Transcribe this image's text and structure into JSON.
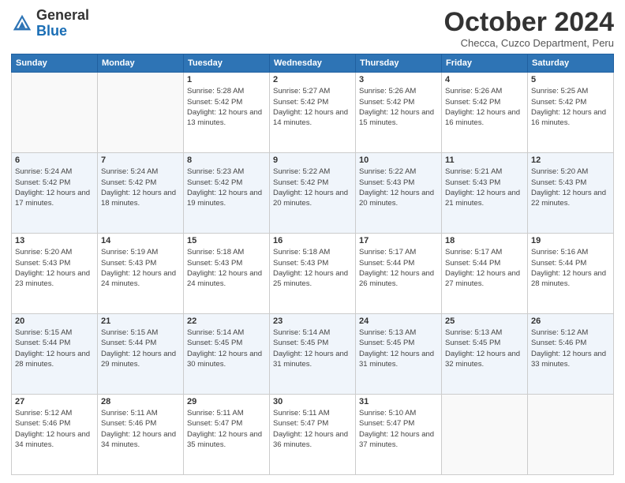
{
  "logo": {
    "general": "General",
    "blue": "Blue"
  },
  "header": {
    "month": "October 2024",
    "location": "Checca, Cuzco Department, Peru"
  },
  "days_of_week": [
    "Sunday",
    "Monday",
    "Tuesday",
    "Wednesday",
    "Thursday",
    "Friday",
    "Saturday"
  ],
  "weeks": [
    [
      {
        "day": "",
        "sunrise": "",
        "sunset": "",
        "daylight": ""
      },
      {
        "day": "",
        "sunrise": "",
        "sunset": "",
        "daylight": ""
      },
      {
        "day": "1",
        "sunrise": "Sunrise: 5:28 AM",
        "sunset": "Sunset: 5:42 PM",
        "daylight": "Daylight: 12 hours and 13 minutes."
      },
      {
        "day": "2",
        "sunrise": "Sunrise: 5:27 AM",
        "sunset": "Sunset: 5:42 PM",
        "daylight": "Daylight: 12 hours and 14 minutes."
      },
      {
        "day": "3",
        "sunrise": "Sunrise: 5:26 AM",
        "sunset": "Sunset: 5:42 PM",
        "daylight": "Daylight: 12 hours and 15 minutes."
      },
      {
        "day": "4",
        "sunrise": "Sunrise: 5:26 AM",
        "sunset": "Sunset: 5:42 PM",
        "daylight": "Daylight: 12 hours and 16 minutes."
      },
      {
        "day": "5",
        "sunrise": "Sunrise: 5:25 AM",
        "sunset": "Sunset: 5:42 PM",
        "daylight": "Daylight: 12 hours and 16 minutes."
      }
    ],
    [
      {
        "day": "6",
        "sunrise": "Sunrise: 5:24 AM",
        "sunset": "Sunset: 5:42 PM",
        "daylight": "Daylight: 12 hours and 17 minutes."
      },
      {
        "day": "7",
        "sunrise": "Sunrise: 5:24 AM",
        "sunset": "Sunset: 5:42 PM",
        "daylight": "Daylight: 12 hours and 18 minutes."
      },
      {
        "day": "8",
        "sunrise": "Sunrise: 5:23 AM",
        "sunset": "Sunset: 5:42 PM",
        "daylight": "Daylight: 12 hours and 19 minutes."
      },
      {
        "day": "9",
        "sunrise": "Sunrise: 5:22 AM",
        "sunset": "Sunset: 5:42 PM",
        "daylight": "Daylight: 12 hours and 20 minutes."
      },
      {
        "day": "10",
        "sunrise": "Sunrise: 5:22 AM",
        "sunset": "Sunset: 5:43 PM",
        "daylight": "Daylight: 12 hours and 20 minutes."
      },
      {
        "day": "11",
        "sunrise": "Sunrise: 5:21 AM",
        "sunset": "Sunset: 5:43 PM",
        "daylight": "Daylight: 12 hours and 21 minutes."
      },
      {
        "day": "12",
        "sunrise": "Sunrise: 5:20 AM",
        "sunset": "Sunset: 5:43 PM",
        "daylight": "Daylight: 12 hours and 22 minutes."
      }
    ],
    [
      {
        "day": "13",
        "sunrise": "Sunrise: 5:20 AM",
        "sunset": "Sunset: 5:43 PM",
        "daylight": "Daylight: 12 hours and 23 minutes."
      },
      {
        "day": "14",
        "sunrise": "Sunrise: 5:19 AM",
        "sunset": "Sunset: 5:43 PM",
        "daylight": "Daylight: 12 hours and 24 minutes."
      },
      {
        "day": "15",
        "sunrise": "Sunrise: 5:18 AM",
        "sunset": "Sunset: 5:43 PM",
        "daylight": "Daylight: 12 hours and 24 minutes."
      },
      {
        "day": "16",
        "sunrise": "Sunrise: 5:18 AM",
        "sunset": "Sunset: 5:43 PM",
        "daylight": "Daylight: 12 hours and 25 minutes."
      },
      {
        "day": "17",
        "sunrise": "Sunrise: 5:17 AM",
        "sunset": "Sunset: 5:44 PM",
        "daylight": "Daylight: 12 hours and 26 minutes."
      },
      {
        "day": "18",
        "sunrise": "Sunrise: 5:17 AM",
        "sunset": "Sunset: 5:44 PM",
        "daylight": "Daylight: 12 hours and 27 minutes."
      },
      {
        "day": "19",
        "sunrise": "Sunrise: 5:16 AM",
        "sunset": "Sunset: 5:44 PM",
        "daylight": "Daylight: 12 hours and 28 minutes."
      }
    ],
    [
      {
        "day": "20",
        "sunrise": "Sunrise: 5:15 AM",
        "sunset": "Sunset: 5:44 PM",
        "daylight": "Daylight: 12 hours and 28 minutes."
      },
      {
        "day": "21",
        "sunrise": "Sunrise: 5:15 AM",
        "sunset": "Sunset: 5:44 PM",
        "daylight": "Daylight: 12 hours and 29 minutes."
      },
      {
        "day": "22",
        "sunrise": "Sunrise: 5:14 AM",
        "sunset": "Sunset: 5:45 PM",
        "daylight": "Daylight: 12 hours and 30 minutes."
      },
      {
        "day": "23",
        "sunrise": "Sunrise: 5:14 AM",
        "sunset": "Sunset: 5:45 PM",
        "daylight": "Daylight: 12 hours and 31 minutes."
      },
      {
        "day": "24",
        "sunrise": "Sunrise: 5:13 AM",
        "sunset": "Sunset: 5:45 PM",
        "daylight": "Daylight: 12 hours and 31 minutes."
      },
      {
        "day": "25",
        "sunrise": "Sunrise: 5:13 AM",
        "sunset": "Sunset: 5:45 PM",
        "daylight": "Daylight: 12 hours and 32 minutes."
      },
      {
        "day": "26",
        "sunrise": "Sunrise: 5:12 AM",
        "sunset": "Sunset: 5:46 PM",
        "daylight": "Daylight: 12 hours and 33 minutes."
      }
    ],
    [
      {
        "day": "27",
        "sunrise": "Sunrise: 5:12 AM",
        "sunset": "Sunset: 5:46 PM",
        "daylight": "Daylight: 12 hours and 34 minutes."
      },
      {
        "day": "28",
        "sunrise": "Sunrise: 5:11 AM",
        "sunset": "Sunset: 5:46 PM",
        "daylight": "Daylight: 12 hours and 34 minutes."
      },
      {
        "day": "29",
        "sunrise": "Sunrise: 5:11 AM",
        "sunset": "Sunset: 5:47 PM",
        "daylight": "Daylight: 12 hours and 35 minutes."
      },
      {
        "day": "30",
        "sunrise": "Sunrise: 5:11 AM",
        "sunset": "Sunset: 5:47 PM",
        "daylight": "Daylight: 12 hours and 36 minutes."
      },
      {
        "day": "31",
        "sunrise": "Sunrise: 5:10 AM",
        "sunset": "Sunset: 5:47 PM",
        "daylight": "Daylight: 12 hours and 37 minutes."
      },
      {
        "day": "",
        "sunrise": "",
        "sunset": "",
        "daylight": ""
      },
      {
        "day": "",
        "sunrise": "",
        "sunset": "",
        "daylight": ""
      }
    ]
  ]
}
